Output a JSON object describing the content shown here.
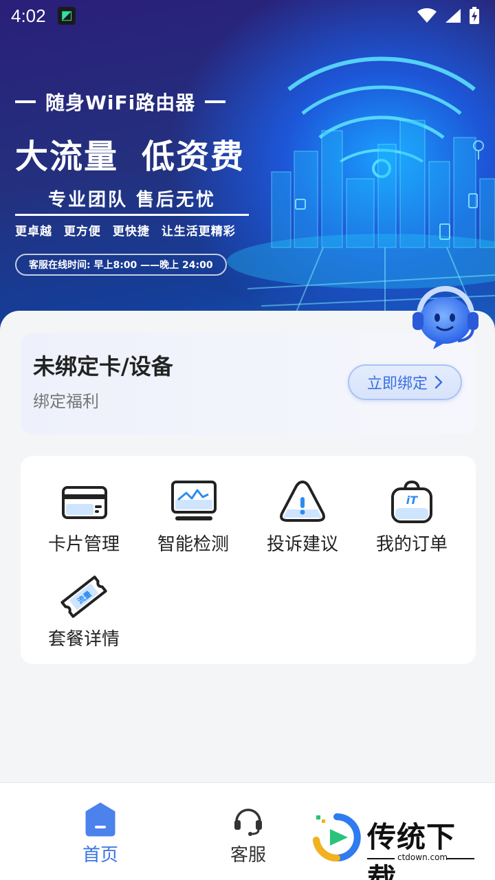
{
  "status_bar": {
    "time": "4:02"
  },
  "banner": {
    "tagline": "随身WiFi路由器",
    "headline_left": "大流量",
    "headline_right": "低资费",
    "team": "专业团队 售后无忧",
    "perks": "更卓越 更方便 更快捷 让生活更精彩",
    "hours": "客服在线时间: 早上8:00 ——晚上 24:00"
  },
  "bind_card": {
    "title": "未绑定卡/设备",
    "subtitle": "绑定福利",
    "button_label": "立即绑定"
  },
  "features": [
    {
      "label": "卡片管理",
      "icon": "card-icon"
    },
    {
      "label": "智能检测",
      "icon": "monitor-icon"
    },
    {
      "label": "投诉建议",
      "icon": "warning-icon"
    },
    {
      "label": "我的订单",
      "icon": "order-bag-icon"
    },
    {
      "label": "套餐详情",
      "icon": "ticket-icon"
    }
  ],
  "bottom_nav": [
    {
      "label": "首页",
      "icon": "home-icon",
      "active": true
    },
    {
      "label": "客服",
      "icon": "headset-icon",
      "active": false
    }
  ],
  "watermark": {
    "title": "传统下载",
    "url": "ctdown.com"
  },
  "colors": {
    "accent": "#3a73e6",
    "banner_dark": "#2a1f7a",
    "banner_light": "#1aa0ff"
  }
}
